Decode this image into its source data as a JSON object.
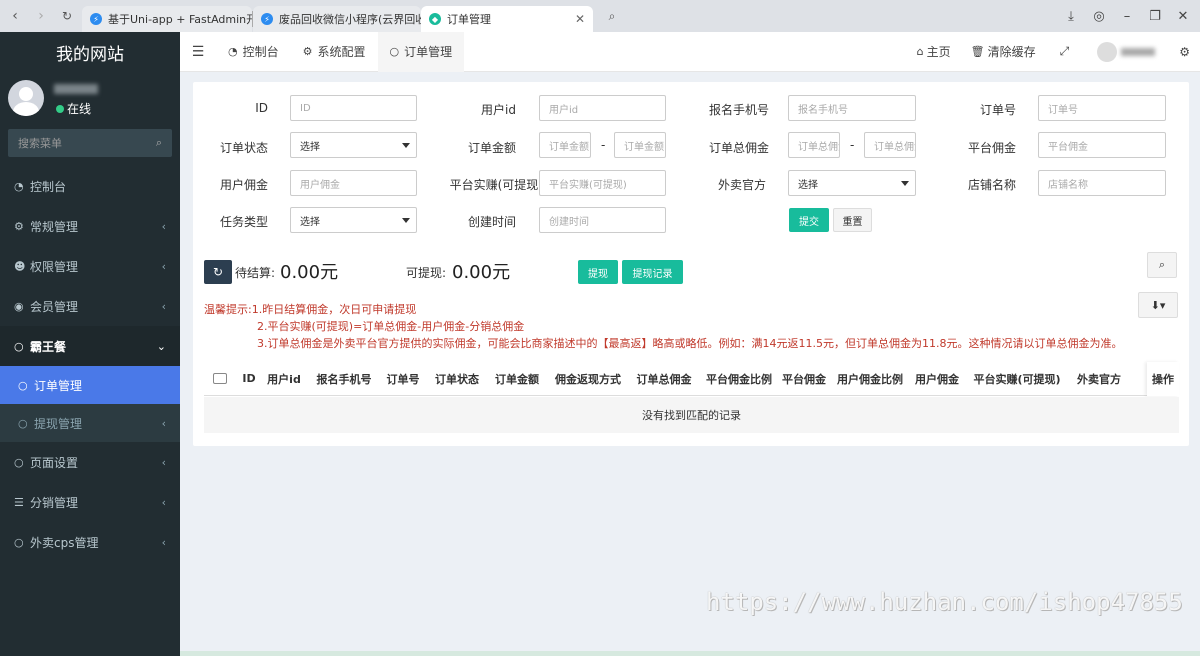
{
  "browser": {
    "tabs": [
      {
        "title": "基于Uni-app + FastAdmin开发的"
      },
      {
        "title": "废品回收微信小程序(云界回收系统"
      },
      {
        "title": "订单管理"
      }
    ]
  },
  "sidebar": {
    "logo": "我的网站",
    "status": "在线",
    "search_placeholder": "搜索菜单",
    "items": [
      {
        "label": "控制台",
        "icon": "dashboard-icon"
      },
      {
        "label": "常规管理",
        "icon": "cogs-icon"
      },
      {
        "label": "权限管理",
        "icon": "group-icon"
      },
      {
        "label": "会员管理",
        "icon": "user-circle-icon"
      },
      {
        "label": "霸王餐",
        "icon": "circle-icon"
      },
      {
        "label": "订单管理",
        "icon": "circle-icon"
      },
      {
        "label": "提现管理",
        "icon": "circle-icon"
      },
      {
        "label": "页面设置",
        "icon": "circle-icon"
      },
      {
        "label": "分销管理",
        "icon": "list-icon"
      },
      {
        "label": "外卖cps管理",
        "icon": "circle-icon"
      }
    ]
  },
  "topbar": {
    "tabs": [
      {
        "label": "控制台"
      },
      {
        "label": "系统配置"
      },
      {
        "label": "订单管理"
      }
    ],
    "home": "主页",
    "clear_cache": "清除缓存"
  },
  "form": {
    "id_label": "ID",
    "id_ph": "ID",
    "uid_label": "用户id",
    "uid_ph": "用户id",
    "phone_label": "报名手机号",
    "phone_ph": "报名手机号",
    "orderno_label": "订单号",
    "orderno_ph": "订单号",
    "status_label": "订单状态",
    "status_value": "选择",
    "amount_label": "订单金额",
    "amount_from_ph": "订单金额",
    "amount_to_ph": "订单金额",
    "total_comm_label": "订单总佣金",
    "total_comm_from_ph": "订单总佣金",
    "total_comm_to_ph": "订单总佣金",
    "plat_comm_label": "平台佣金",
    "plat_comm_ph": "平台佣金",
    "user_comm_label": "用户佣金",
    "user_comm_ph": "用户佣金",
    "plat_real_label": "平台实赚(可提现)",
    "plat_real_ph": "平台实赚(可提现)",
    "official_label": "外卖官方",
    "official_value": "选择",
    "shop_label": "店铺名称",
    "shop_ph": "店铺名称",
    "task_label": "任务类型",
    "task_value": "选择",
    "created_label": "创建时间",
    "created_ph": "创建时间",
    "submit": "提交",
    "reset": "重置"
  },
  "summary": {
    "pending_label": "待结算:",
    "pending_value": "0.00元",
    "withdrawable_label": "可提现:",
    "withdrawable_value": "0.00元",
    "withdraw_btn": "提现",
    "withdraw_log_btn": "提现记录"
  },
  "notice": {
    "title": "温馨提示:",
    "line1": "1.昨日结算佣金，次日可申请提现",
    "line2": "2.平台实赚(可提现)=订单总佣金-用户佣金-分销总佣金",
    "line3": "3.订单总佣金是外卖平台官方提供的实际佣金，可能会比商家描述中的【最高返】略高或略低。例如：满14元返11.5元，但订单总佣金为11.8元。这种情况请以订单总佣金为准。"
  },
  "table": {
    "columns": [
      "ID",
      "用户id",
      "报名手机号",
      "订单号",
      "订单状态",
      "订单金额",
      "佣金返现方式",
      "订单总佣金",
      "平台佣金比例",
      "平台佣金",
      "用户佣金比例",
      "用户佣金",
      "平台实赚(可提现)",
      "外卖官方"
    ],
    "op_column": "操作",
    "empty_text": "没有找到匹配的记录"
  },
  "watermark": "https://www.huzhan.com/ishop47855"
}
